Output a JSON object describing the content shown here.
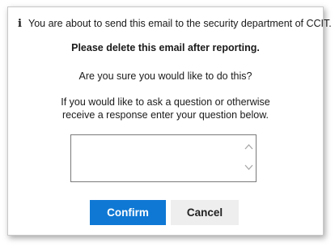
{
  "dialog": {
    "info_icon": "i",
    "info_text": "You are about to send this email to the security department of CCIT.",
    "bold_message": "Please delete this email after reporting.",
    "question": "Are you sure you would like to do this?",
    "instructions_line1": "If you would like to ask a question or otherwise",
    "instructions_line2": "receive a response enter your question below.",
    "response_value": "",
    "response_placeholder": "",
    "confirm_label": "Confirm",
    "cancel_label": "Cancel"
  },
  "icons": {
    "info": "info-icon",
    "scroll_up": "chevron-up-icon",
    "scroll_down": "chevron-down-icon"
  },
  "colors": {
    "confirm_bg": "#0f78d4",
    "cancel_bg": "#eeeeee"
  }
}
